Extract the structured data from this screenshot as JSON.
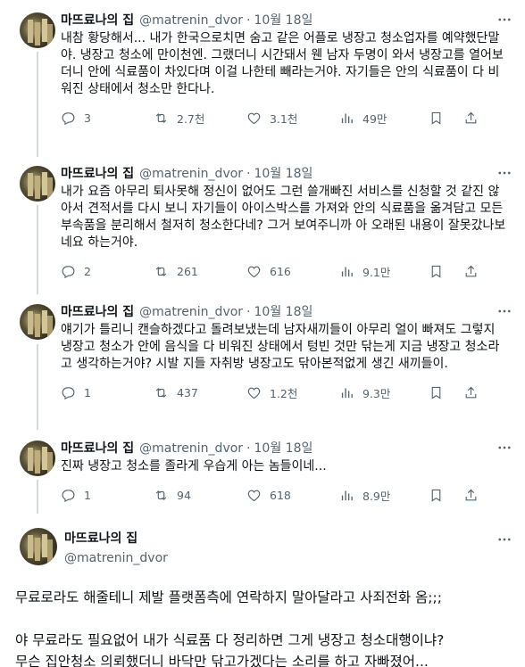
{
  "tweets": [
    {
      "display_name": "마뜨료나의 집",
      "handle": "@matrenin_dvor",
      "time": "10월 18일",
      "text": "내참 황당해서... 내가 한국으로치면 숨고 같은 어플로 냉장고 청소업자를 예약했단말야. 냉장고 청소에 만이천엔. 그랬더니 시간돼서 웬 남자 두명이 와서 냉장고를 열어보더니 안에 식료품이 차있다며 이걸 나한테 빼라는거야. 자기들은 안의 식료품이 다 비워진 상태에서 청소만 한다나.",
      "replies": "3",
      "retweets": "2.7천",
      "likes": "3.1천",
      "views": "49만"
    },
    {
      "display_name": "마뜨료나의 집",
      "handle": "@matrenin_dvor",
      "time": "10월 18일",
      "text": "내가 요즘 아무리 퇴사못해 정신이 없어도 그런 쓸개빠진 서비스를 신청할 것 같진 않아서 견적서를 다시 보니 자기들이 아이스박스를 가져와 안의 식료품을 옮겨담고 모든 부속품을 분리해서 철저히 청소한다네? 그거 보여주니까 아 오래된 내용이 잘못갔나보네요 하는거야.",
      "replies": "2",
      "retweets": "261",
      "likes": "616",
      "views": "9.1만"
    },
    {
      "display_name": "마뜨료나의 집",
      "handle": "@matrenin_dvor",
      "time": "10월 18일",
      "text": "얘기가 틀리니 캔슬하겠다고 돌려보냈는데 남자새끼들이 아무리 얼이 빠져도 그렇지 냉장고 청소가 안에 음식을 다 비워진 상태에서 텅빈 것만 닦는게 지금 냉장고 청소라고 생각하는거야? 시발 지들 자취방 냉장고도 닦아본적없게 생긴 새끼들이.",
      "replies": "1",
      "retweets": "437",
      "likes": "1.2천",
      "views": "9.3만"
    },
    {
      "display_name": "마뜨료나의 집",
      "handle": "@matrenin_dvor",
      "time": "10월 18일",
      "text": "진짜 냉장고 청소를 졸라게 우습게 아는 놈들이네...",
      "replies": "1",
      "retweets": "94",
      "likes": "618",
      "views": "8.9만"
    }
  ],
  "final_tweet": {
    "display_name": "마뜨료나의 집",
    "handle": "@matrenin_dvor",
    "para1": "무료로라도 해줄테니 제발 플랫폼측에 연락하지 말아달라고 사죄전화 옴;;;",
    "para2_line1": "야 무료라도 필요없어 내가 식료품 다 정리하면 그게 냉장고 청소대행이냐?",
    "para2_line2": "무슨 집안청소 의뢰했더니 바닥만 닦고가겠다는 소리를 하고 자빠졌어..."
  },
  "colors": {
    "text": "#0f1419",
    "muted": "#536471",
    "thread_line": "#cfd9de"
  }
}
